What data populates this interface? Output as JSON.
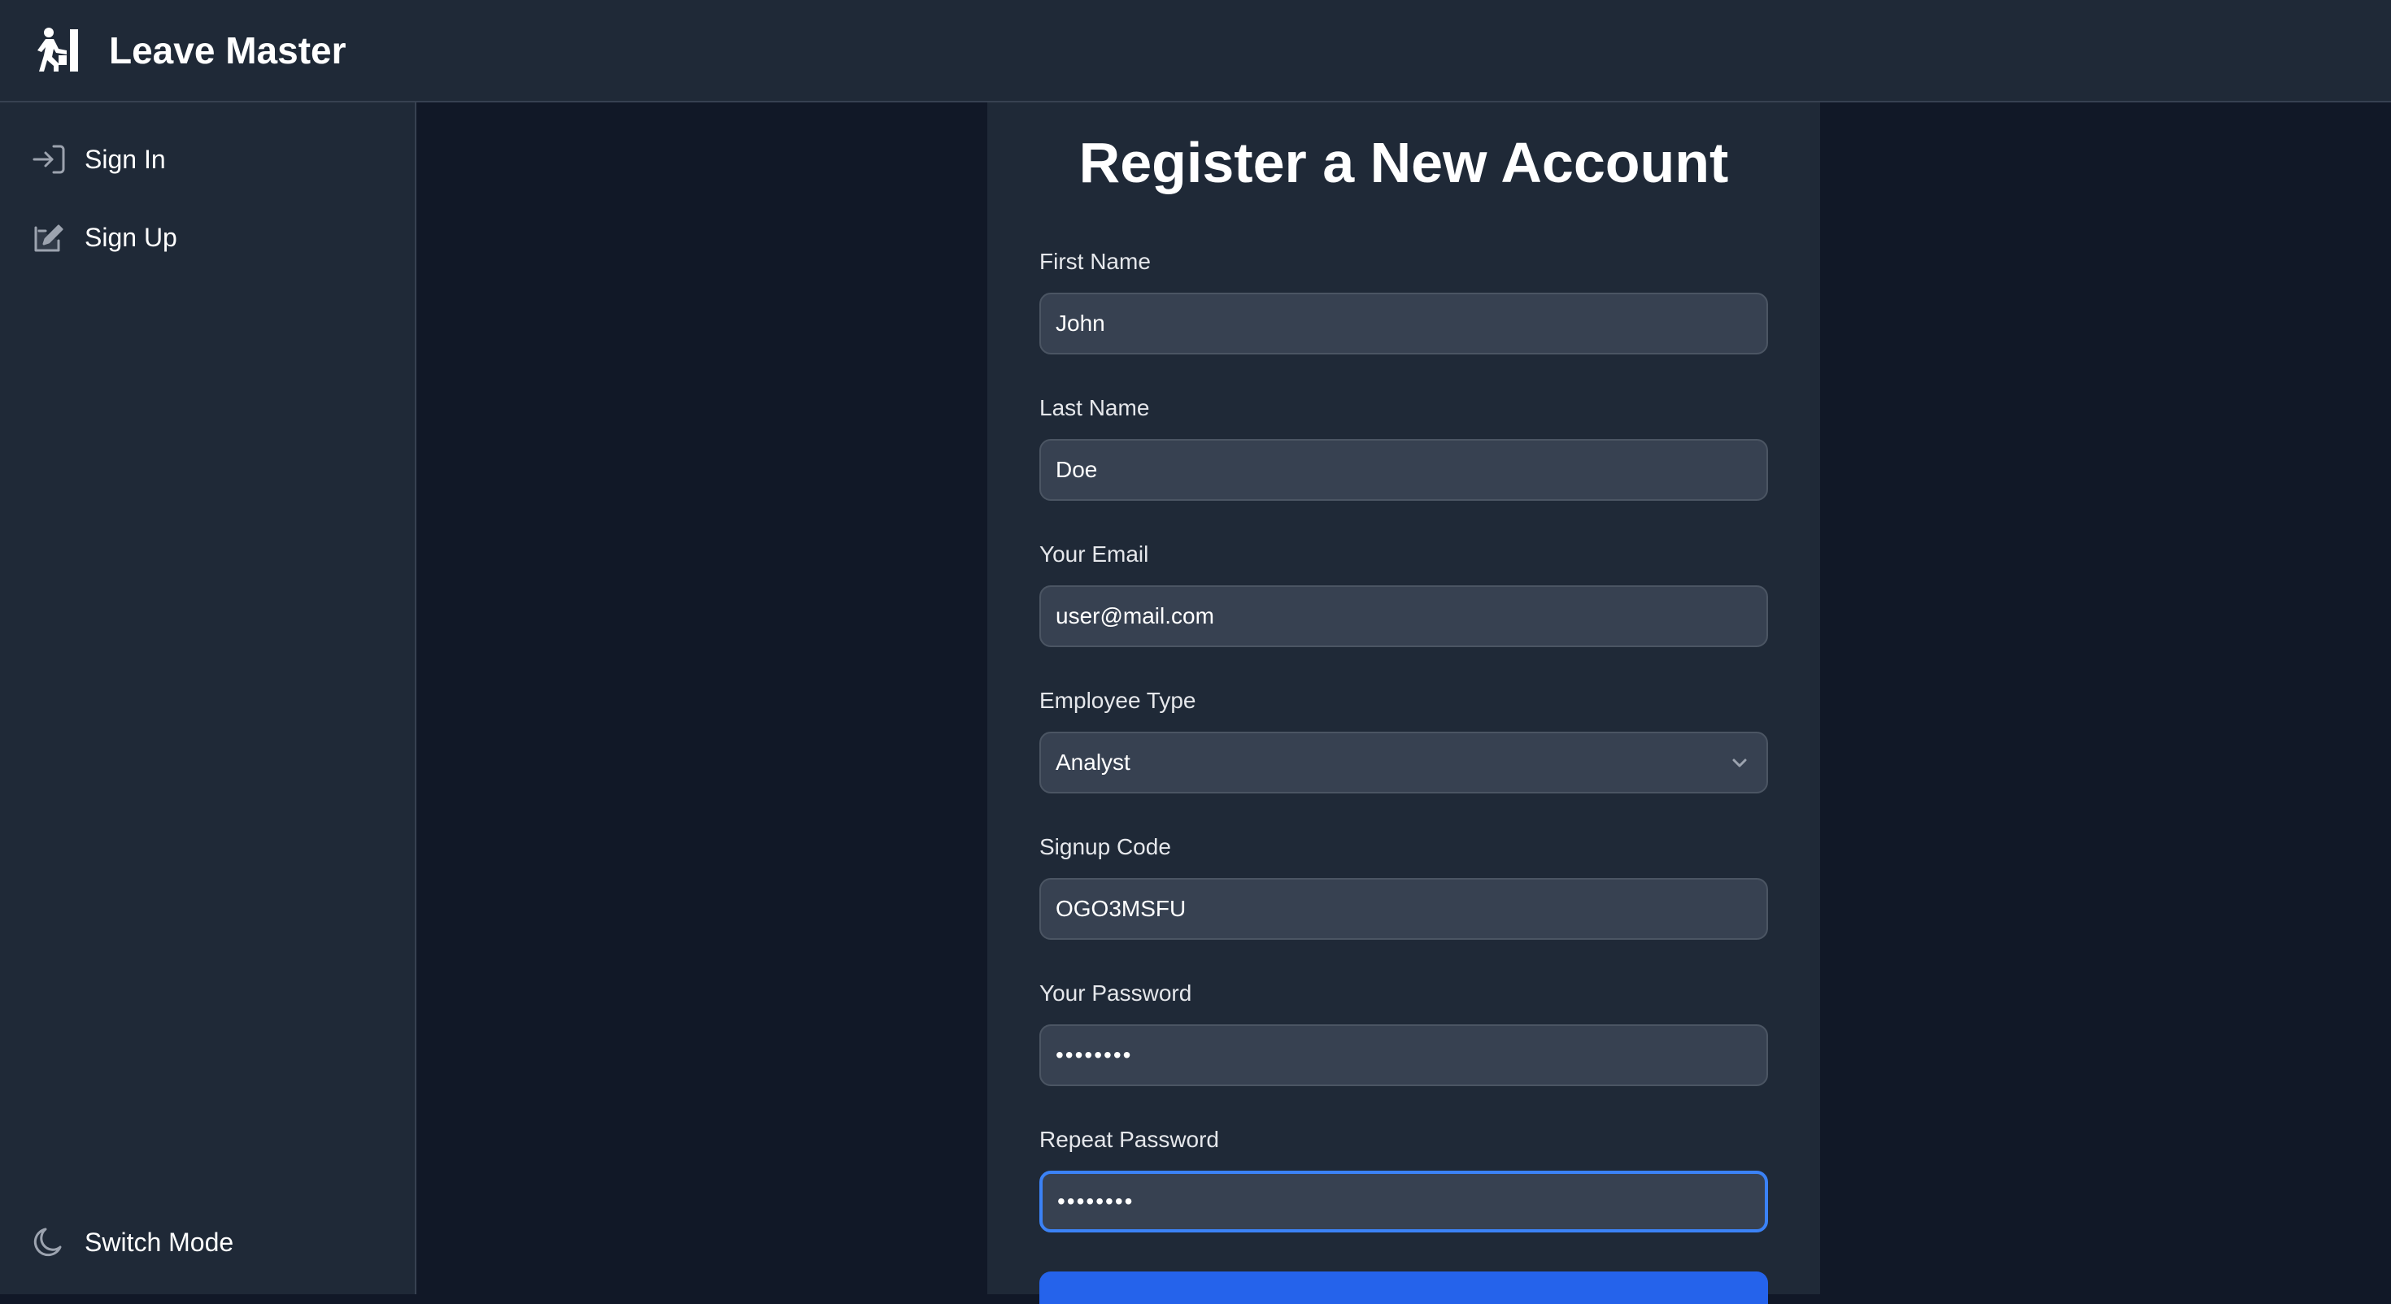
{
  "app": {
    "title": "Leave Master"
  },
  "sidebar": {
    "items": [
      {
        "label": "Sign In",
        "icon": "sign-in-icon"
      },
      {
        "label": "Sign Up",
        "icon": "sign-up-icon"
      }
    ],
    "switch_mode": {
      "label": "Switch Mode",
      "icon": "moon-icon"
    }
  },
  "form": {
    "title": "Register a New Account",
    "fields": {
      "first_name": {
        "label": "First Name",
        "value": "John"
      },
      "last_name": {
        "label": "Last Name",
        "value": "Doe"
      },
      "email": {
        "label": "Your Email",
        "value": "user@mail.com"
      },
      "employee_type": {
        "label": "Employee Type",
        "value": "Analyst"
      },
      "signup_code": {
        "label": "Signup Code",
        "value": "OGO3MSFU"
      },
      "password": {
        "label": "Your Password",
        "value": "••••••••"
      },
      "repeat_password": {
        "label": "Repeat Password",
        "value": "••••••••"
      }
    }
  },
  "colors": {
    "background": "#111827",
    "panel": "#1f2937",
    "input": "#374151",
    "accent": "#2563eb"
  }
}
